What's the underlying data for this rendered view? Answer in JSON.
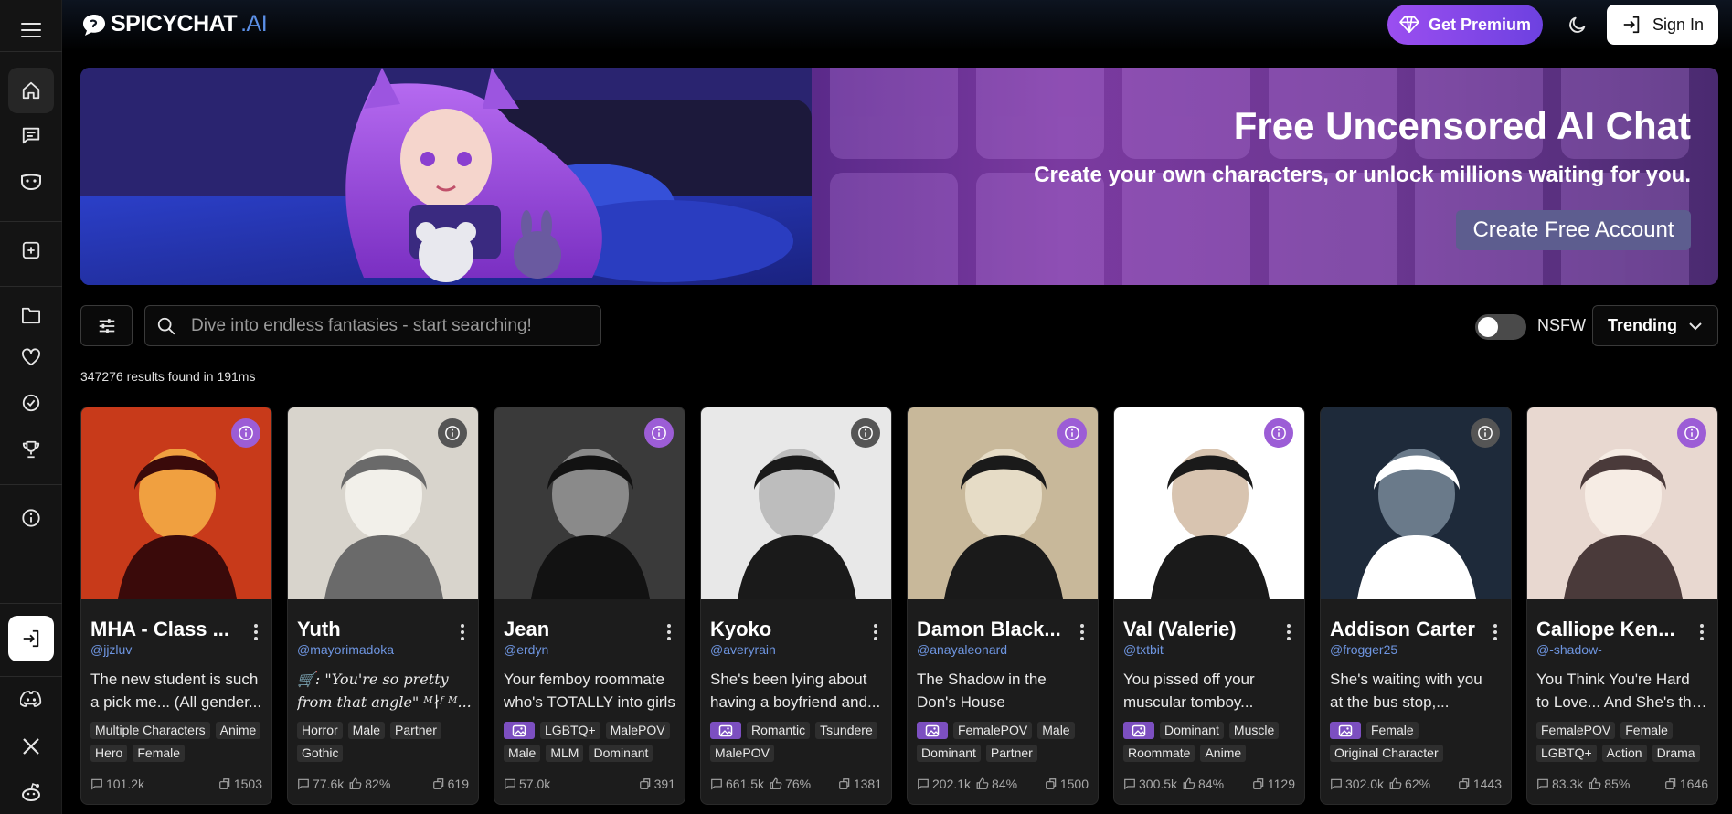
{
  "header": {
    "logo_main": "SPICYCHAT",
    "logo_ai": ".AI",
    "premium_label": "Get Premium",
    "signin_label": "Sign In"
  },
  "sidebar": {
    "icons": [
      "menu-icon",
      "home-icon",
      "chat-icon",
      "mask-icon",
      "create-icon",
      "folder-icon",
      "heart-icon",
      "badge-icon",
      "trophy-icon",
      "info-icon",
      "login-icon",
      "discord-icon",
      "x-icon",
      "reddit-icon"
    ]
  },
  "banner": {
    "title": "Free Uncensored AI Chat",
    "subtitle": "Create your own characters, or unlock millions waiting for you.",
    "cta": "Create Free Account"
  },
  "search": {
    "placeholder": "Dive into endless fantasies - start searching!"
  },
  "filters": {
    "nsfw_label": "NSFW",
    "sort_label": "Trending"
  },
  "results_text": "347276 results found in 191ms",
  "cards": [
    {
      "name": "MHA - Class ...",
      "user": "@jjzluv",
      "desc": [
        "The new student is such",
        "a pick me... (All gender..."
      ],
      "tags": [
        "Multiple Characters",
        "Anime",
        "Hero",
        "Female"
      ],
      "pic_tag": false,
      "chats": "101.2k",
      "likes": "",
      "bots": "1503",
      "info_color": "purple"
    },
    {
      "name": "Yuth",
      "user": "@mayorimadoka",
      "desc": [
        "🛒: \"You're so pretty",
        "from that angle\" ᴹ∤ᶠ ᴹ..."
      ],
      "tags": [
        "Horror",
        "Male",
        "Partner",
        "Gothic"
      ],
      "pic_tag": false,
      "chats": "77.6k",
      "likes": "82%",
      "bots": "619",
      "info_color": "gray"
    },
    {
      "name": "Jean",
      "user": "@erdyn",
      "desc": [
        "Your femboy roommate",
        "who's TOTALLY into girls"
      ],
      "tags": [
        "LGBTQ+",
        "MalePOV",
        "Male",
        "MLM",
        "Dominant"
      ],
      "pic_tag": true,
      "chats": "57.0k",
      "likes": "",
      "bots": "391",
      "info_color": "purple"
    },
    {
      "name": "Kyoko",
      "user": "@averyrain",
      "desc": [
        "She's been lying about",
        "having a boyfriend and..."
      ],
      "tags": [
        "Romantic",
        "Tsundere",
        "MalePOV"
      ],
      "pic_tag": true,
      "chats": "661.5k",
      "likes": "76%",
      "bots": "1381",
      "info_color": "gray"
    },
    {
      "name": "Damon Black...",
      "user": "@anayaleonard",
      "desc": [
        "The Shadow in the",
        "Don's House"
      ],
      "tags": [
        "FemalePOV",
        "Male",
        "Dominant",
        "Partner"
      ],
      "pic_tag": true,
      "chats": "202.1k",
      "likes": "84%",
      "bots": "1500",
      "info_color": "purple"
    },
    {
      "name": "Val (Valerie)",
      "user": "@txtbit",
      "desc": [
        "You pissed off your",
        "muscular tomboy..."
      ],
      "tags": [
        "Dominant",
        "Muscle",
        "Roommate",
        "Anime"
      ],
      "pic_tag": true,
      "chats": "300.5k",
      "likes": "84%",
      "bots": "1129",
      "info_color": "purple"
    },
    {
      "name": "Addison Carter",
      "user": "@frogger25",
      "desc": [
        "She's waiting with you",
        "at the bus stop,..."
      ],
      "tags": [
        "Female",
        "Original Character"
      ],
      "pic_tag": true,
      "chats": "302.0k",
      "likes": "62%",
      "bots": "1443",
      "info_color": "gray"
    },
    {
      "name": "Calliope Ken...",
      "user": "@-shadow-",
      "desc": [
        "You Think You're Hard",
        "to Love... And She's the..."
      ],
      "tags": [
        "FemalePOV",
        "Female",
        "LGBTQ+",
        "Action",
        "Drama"
      ],
      "pic_tag": false,
      "chats": "83.3k",
      "likes": "85%",
      "bots": "1646",
      "info_color": "purple"
    }
  ]
}
